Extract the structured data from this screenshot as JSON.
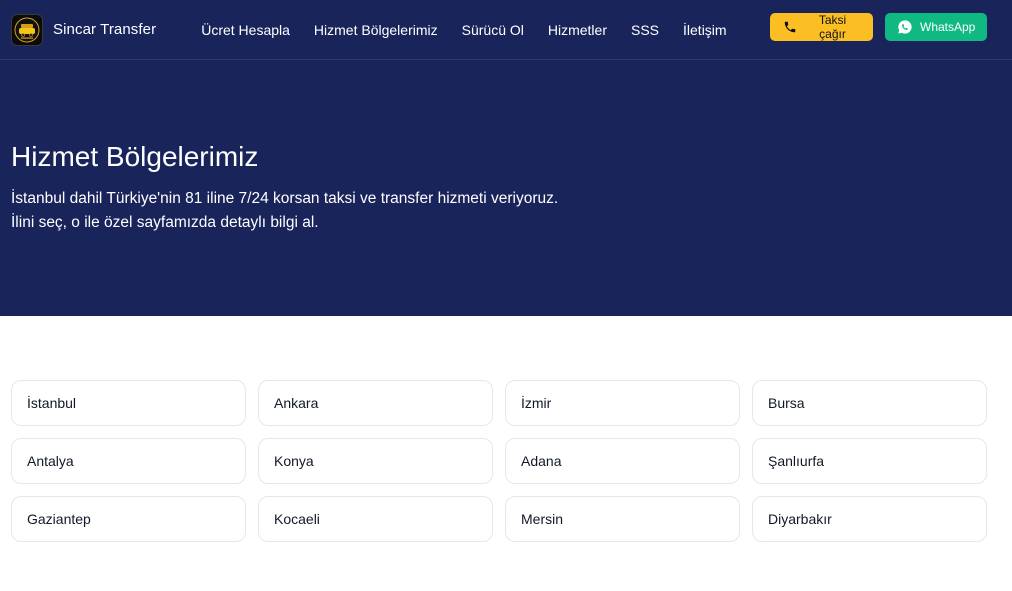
{
  "brand": {
    "name": "Sincar Transfer",
    "logo_icon": "taxi-logo-icon"
  },
  "nav": {
    "links": [
      "Ücret Hesapla",
      "Hizmet Bölgelerimiz",
      "Sürücü Ol",
      "Hizmetler",
      "SSS",
      "İletişim"
    ]
  },
  "actions": {
    "taxi_label": "Taksi çağır",
    "taxi_icon": "phone-icon",
    "taxi_color": "#fbbf24",
    "whatsapp_label": "WhatsApp",
    "whatsapp_icon": "whatsapp-icon",
    "whatsapp_color": "#10b981"
  },
  "hero": {
    "title": "Hizmet Bölgelerimiz",
    "line1": "İstanbul dahil Türkiye'nin 81 iline 7/24 korsan taksi ve transfer hizmeti veriyoruz.",
    "line2": "İlini seç, o ile özel sayfamızda detaylı bilgi al.",
    "background": "#19245a"
  },
  "cities": [
    "İstanbul",
    "Ankara",
    "İzmir",
    "Bursa",
    "Antalya",
    "Konya",
    "Adana",
    "Şanlıurfa",
    "Gaziantep",
    "Kocaeli",
    "Mersin",
    "Diyarbakır"
  ]
}
